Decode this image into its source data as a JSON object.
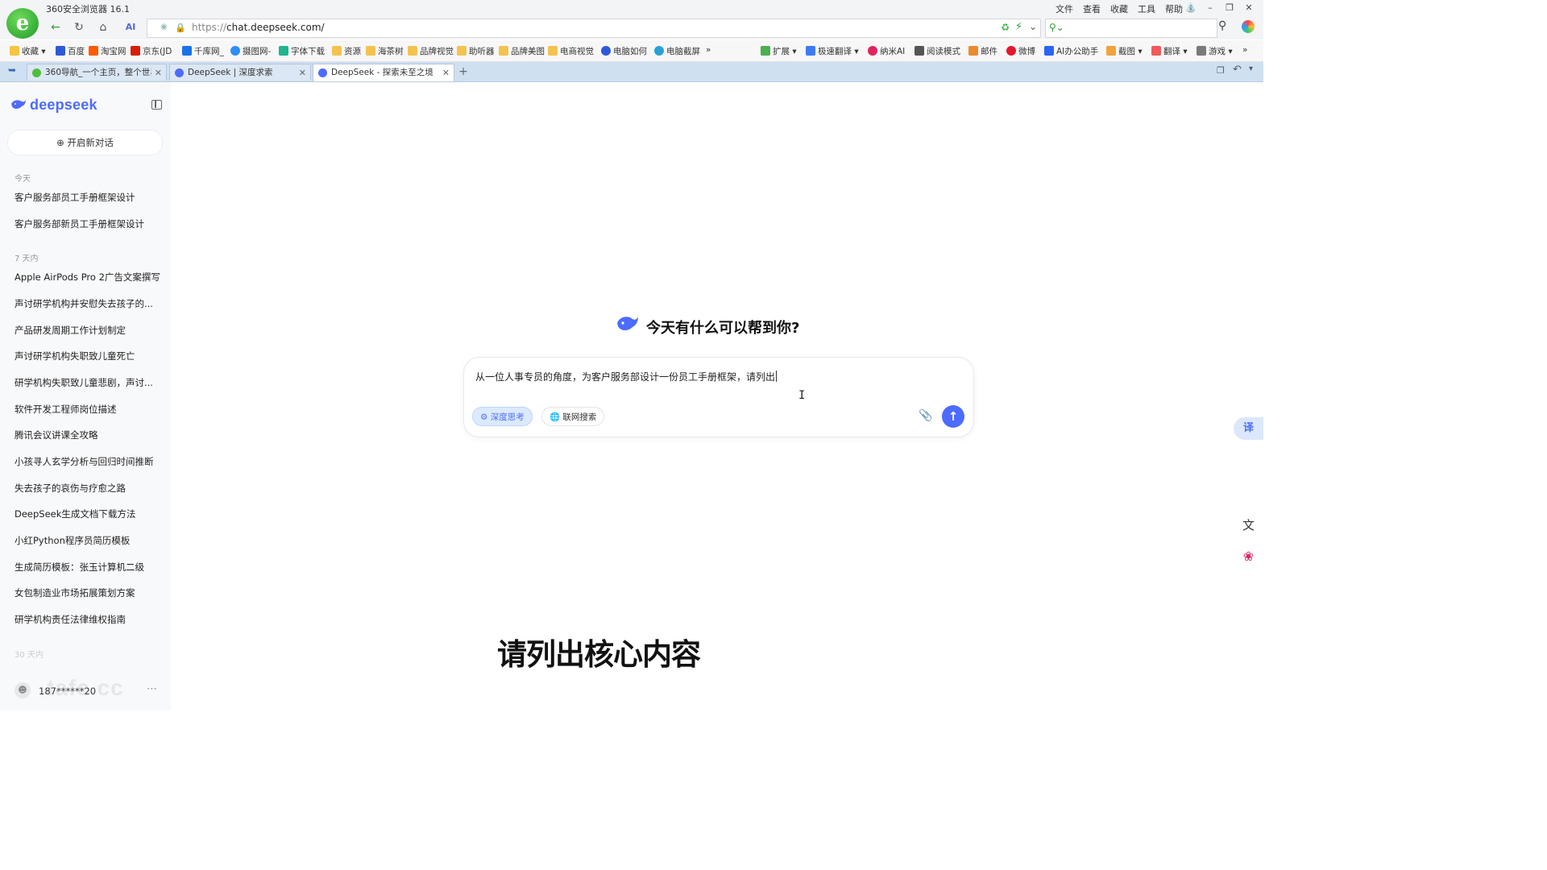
{
  "browser": {
    "title": "360安全浏览器 16.1",
    "menu": [
      "文件",
      "查看",
      "收藏",
      "工具",
      "帮助"
    ],
    "url_protocol": "https://",
    "url_host": "chat.deepseek.com/",
    "bookmarks": [
      "收藏",
      "百度",
      "淘宝网",
      "京东(JD",
      "千库网_",
      "摄图网-",
      "字体下载",
      "资源",
      "海茶树",
      "品牌视觉",
      "助听器",
      "品牌美图",
      "电商视觉",
      "电脑如何",
      "电脑截屏"
    ],
    "toolbar_right": [
      "扩展",
      "极速翻译",
      "纳米AI",
      "阅读模式",
      "邮件",
      "微博",
      "AI办公助手",
      "截图",
      "翻译",
      "游戏"
    ],
    "tabs": [
      {
        "label": "360导航_一个主页，整个世界"
      },
      {
        "label": "DeepSeek | 深度求索"
      },
      {
        "label": "DeepSeek - 探索未至之境"
      }
    ]
  },
  "sidebar": {
    "brand": "deepseek",
    "new_chat": "开启新对话",
    "groups": [
      {
        "label": "今天",
        "items": [
          "客户服务部员工手册框架设计",
          "客户服务部新员工手册框架设计"
        ]
      },
      {
        "label": "7 天内",
        "items": [
          "Apple AirPods Pro 2广告文案撰写",
          "声讨研学机构并安慰失去孩子的...",
          "产品研发周期工作计划制定",
          "声讨研学机构失职致儿童死亡",
          "研学机构失职致儿童悲剧，声讨...",
          "软件开发工程师岗位描述",
          "腾讯会议讲课全攻略",
          "小孩寻人玄学分析与回归时间推断",
          "失去孩子的哀伤与疗愈之路",
          "DeepSeek生成文档下载方法",
          "小红Python程序员简历模板",
          "生成简历模板：张玉计算机二级",
          "女包制造业市场拓展策划方案",
          "研学机构责任法律维权指南"
        ]
      },
      {
        "label": "30 天内",
        "items": []
      }
    ],
    "user": "187******20",
    "watermark": "tafe.cc"
  },
  "main": {
    "greeting": "今天有什么可以帮到你?",
    "input_text": "从一位人事专员的角度，为客户服务部设计一份员工手册框架，请列出",
    "deep_think": "深度思考",
    "web_search": "联网搜索",
    "subtitle": "请列出核心内容",
    "translate_label": "译"
  },
  "colors": {
    "accent": "#4d6bfe",
    "sidebar_bg": "#f8f9fb",
    "tabbar_bg": "#cfe0f1"
  }
}
